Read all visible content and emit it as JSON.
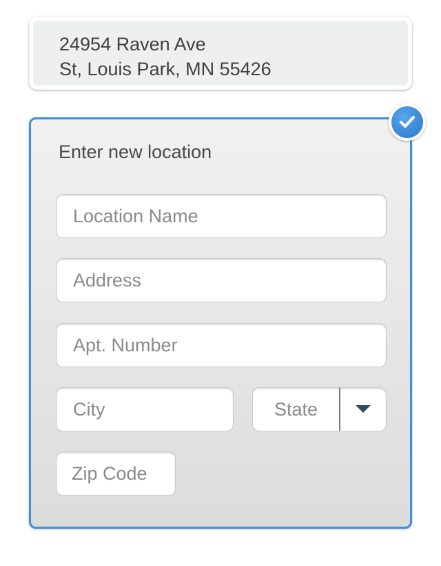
{
  "saved_location": {
    "line1": "24954 Raven Ave",
    "line2": "St, Louis Park, MN 55426"
  },
  "new_location": {
    "title": "Enter new location",
    "selected": true,
    "fields": {
      "location_name_placeholder": "Location Name",
      "address_placeholder": "Address",
      "apt_placeholder": "Apt. Number",
      "city_placeholder": "City",
      "state_label": "State",
      "zip_placeholder": "Zip Code"
    }
  },
  "colors": {
    "accent": "#3d8edc",
    "card_background": "#e6e6e5",
    "text": "#4a4a4a",
    "placeholder": "#8a8a8a"
  },
  "icons": {
    "selected_badge": "checkmark-icon",
    "state_dropdown": "caret-down-icon"
  }
}
